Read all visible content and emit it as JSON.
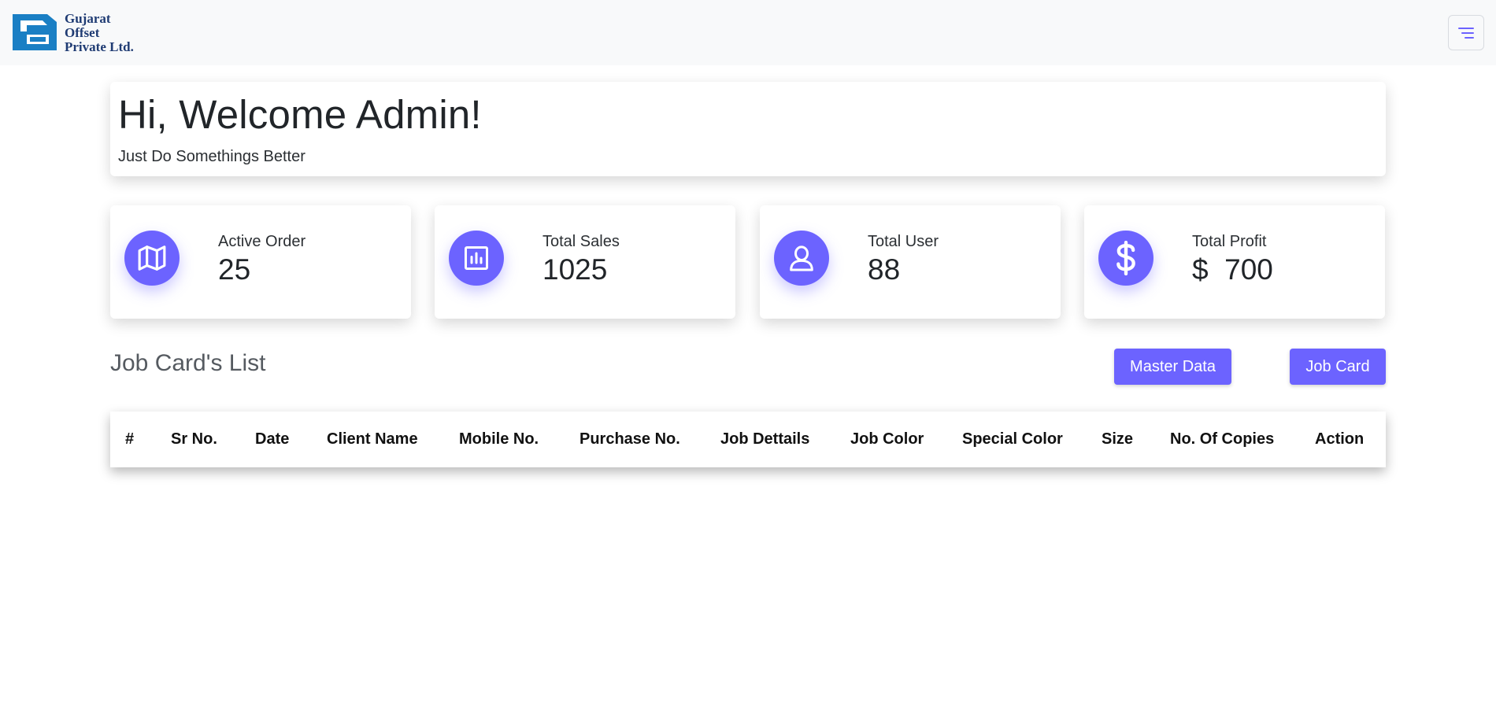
{
  "brand": {
    "line1": "Gujarat",
    "line2": "Offset",
    "line3": "Private Ltd.",
    "logo_color": "#1a7fc4"
  },
  "navbar": {
    "toggler_icon": "menu-lines-icon"
  },
  "welcome": {
    "title": "Hi, Welcome Admin!",
    "subtitle": "Just Do Somethings Better"
  },
  "stats": [
    {
      "label": "Active Order",
      "value": "25",
      "icon": "map-icon"
    },
    {
      "label": "Total Sales",
      "value": "1025",
      "icon": "bar-chart-icon"
    },
    {
      "label": "Total User",
      "value": "88",
      "icon": "user-icon"
    },
    {
      "label": "Total Profit",
      "value": "$  700",
      "icon": "dollar-icon"
    }
  ],
  "job_cards": {
    "title": "Job Card's List",
    "master_data_button": "Master Data",
    "job_card_button": "Job Card",
    "columns": [
      "#",
      "Sr No.",
      "Date",
      "Client Name",
      "Mobile No.",
      "Purchase No.",
      "Job Dettails",
      "Job Color",
      "Special Color",
      "Size",
      "No. Of Copies",
      "Action"
    ]
  },
  "colors": {
    "accent": "#6c63ff",
    "navbar_bg": "#f8f9fa"
  }
}
